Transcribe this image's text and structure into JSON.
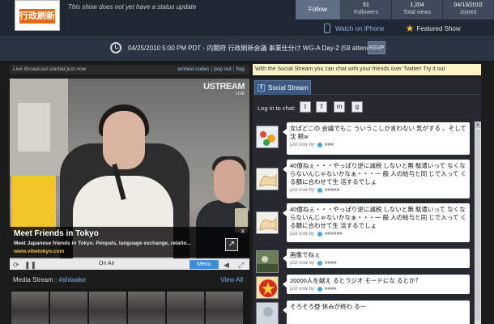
{
  "header": {
    "logo_text": "行政刷新",
    "status": "This show does not yet have a status update",
    "follow_label": "Follow",
    "stats": [
      {
        "value": "51",
        "label": "Followers"
      },
      {
        "value": "1,204",
        "label": "Total views"
      },
      {
        "value": "04/13/2010",
        "label": "Joined"
      }
    ],
    "iphone_link": "Watch on iPhone",
    "featured_link": "Featured Show"
  },
  "event": {
    "text": "04/25/2010 5:00 PM PDT - 内閣府 行政刷新会議 事業仕分け WG-A Day-2 (59 attending)",
    "rsvp_label": "RSVP"
  },
  "player": {
    "live_text": "Live Broadcast started just now",
    "links": [
      "embed codes",
      "pop out",
      "flag"
    ],
    "watermark": "USTREAM",
    "watermark_sub": "LIVE",
    "ad": {
      "title": "Meet Friends in Tokyo",
      "description": "Meet Japanese friends in Tokyo. Penpals, language exchange, relatio...",
      "url": "www.vibetokyo.com",
      "close": "X"
    },
    "controls": {
      "status": "On Air",
      "menu_label": "Menu"
    }
  },
  "media_stream": {
    "label": "Media Stream : ",
    "tag": "#shiwake",
    "view_all": "View All"
  },
  "social": {
    "promo": "With the Social Stream you can chat with your friends over Twitter! Try it out",
    "tab_label": "Social Stream",
    "login_label": "Log in to chat:",
    "login_services": [
      "t",
      "f",
      "m",
      "g"
    ],
    "messages": [
      {
        "text": "女ばどこの 会議でもこ ういうこしか言わない 気がする 。そして沈 黙w",
        "time": "just now by",
        "user": "■■■"
      },
      {
        "text": "40億ねぇ・・・やっぱり逆に減税 しないと無 駄遣いって なくならないんじゃないかなぁ・・・一 般 人の給与と同 じで入って くる額に合わせて生 活するでしょ",
        "time": "just now by",
        "user": "■■■■■"
      },
      {
        "text": "40億ねぇ・・・やっぱり逆に減税 しないと無 駄遣いって なくならないんじゃないかなぁ・・・一 般 人の給与と同 じで入って くる額に合わせて生 活するでしょ",
        "time": "just now by",
        "user": "■■■■■■"
      },
      {
        "text": "画像でねぇ",
        "time": "just now by",
        "user": "■■■■"
      },
      {
        "text": "20000人を越え るとラジオ モードにな るとか？",
        "time": "just now by",
        "user": "■■■■"
      },
      {
        "text": "そろそろ昼 休みが終わ るー",
        "time": "",
        "user": ""
      }
    ]
  },
  "colors": {
    "accent": "#3d8ed6",
    "header_bg": "#1f2733",
    "link": "#8fb3e6",
    "promo_bg": "#fdf4c6"
  },
  "icons": {
    "clock": "clock-icon",
    "star": "star-icon",
    "phone": "phone-icon",
    "facebook": "facebook-icon",
    "twitter": "twitter-icon"
  }
}
